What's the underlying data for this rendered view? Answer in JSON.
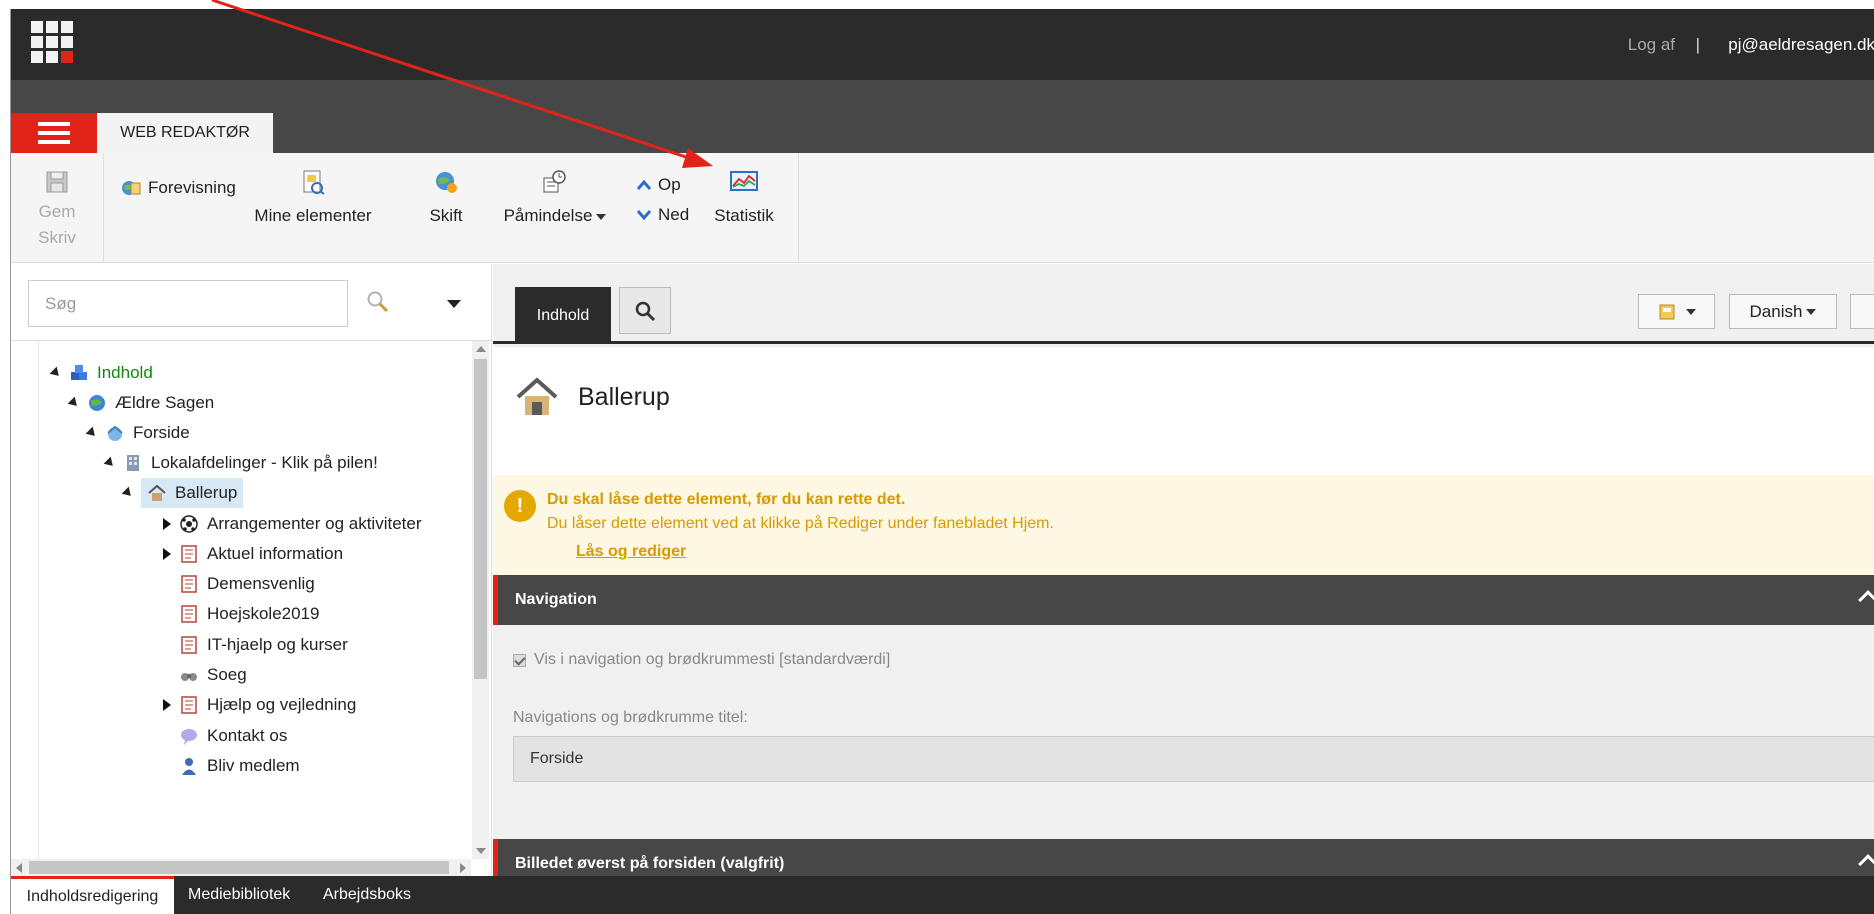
{
  "header": {
    "logout_label": "Log af",
    "separator": "|",
    "user_email": "pj@aeldresagen.dk"
  },
  "tabstrip": {
    "web_editor_tab": "WEB REDAKTØR"
  },
  "ribbon": {
    "save_label": "Gem",
    "write_label": "Skriv",
    "preview_label": "Forevisning",
    "my_items_label": "Mine elementer",
    "shift_label": "Skift",
    "reminder_label": "Påmindelse",
    "up_label": "Op",
    "down_label": "Ned",
    "statistics_label": "Statistik"
  },
  "search": {
    "placeholder": "Søg"
  },
  "tree": {
    "items": [
      {
        "label": "Indhold"
      },
      {
        "label": "Ældre Sagen"
      },
      {
        "label": "Forside"
      },
      {
        "label": "Lokalafdelinger - Klik på pilen!"
      },
      {
        "label": "Ballerup"
      },
      {
        "label": "Arrangementer og aktiviteter"
      },
      {
        "label": "Aktuel information"
      },
      {
        "label": "Demensvenlig"
      },
      {
        "label": "Hoejskole2019"
      },
      {
        "label": "IT-hjaelp og kurser"
      },
      {
        "label": "Soeg"
      },
      {
        "label": "Hjælp og vejledning"
      },
      {
        "label": "Kontakt os"
      },
      {
        "label": "Bliv medlem"
      }
    ]
  },
  "content": {
    "tab_content_label": "Indhold",
    "language_label": "Danish",
    "page_title": "Ballerup",
    "warning_title": "Du skal låse dette element, før du kan rette det.",
    "warning_text": "Du låser dette element ved at klikke på Rediger under fanebladet Hjem.",
    "warning_link": "Lås og rediger",
    "section_navigation": "Navigation",
    "checkbox_label": "Vis i navigation og brødkrummesti [standardværdi]",
    "nav_title_label": "Navigations og brødkrumme titel:",
    "nav_title_value": "Forside",
    "section_image": "Billedet øverst på forsiden (valgfrit)"
  },
  "bottom_tabs": [
    {
      "label": "Indholdsredigering"
    },
    {
      "label": "Mediebibliotek"
    },
    {
      "label": "Arbejdsboks"
    }
  ],
  "colors": {
    "accent_red": "#e2231a",
    "dark_bar": "#2b2b2b",
    "warning_text": "#d79a00",
    "annotation_arrow": "#e2231a"
  }
}
